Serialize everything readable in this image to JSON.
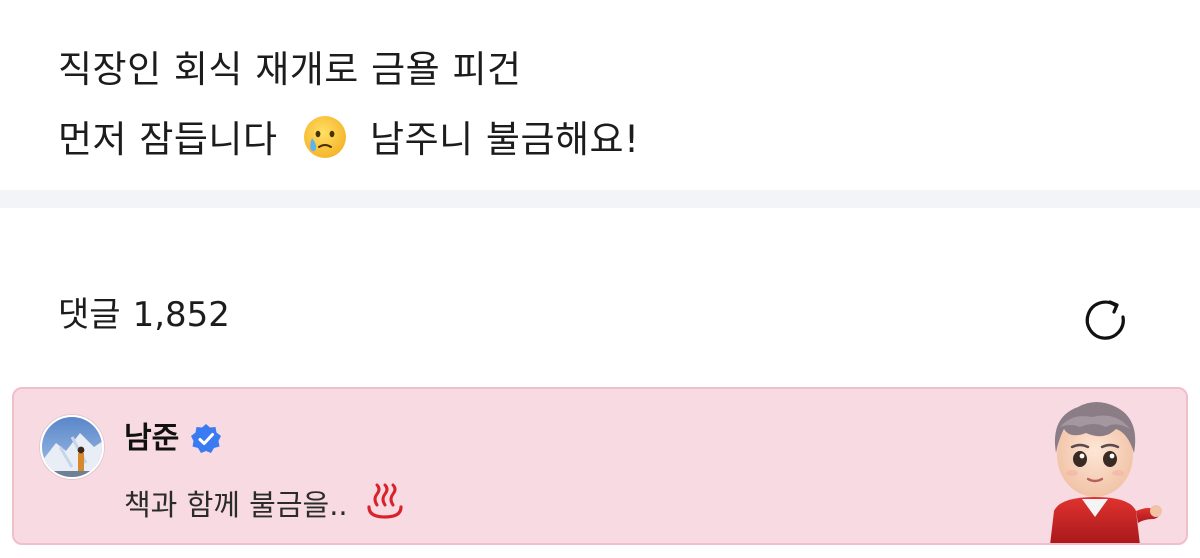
{
  "post": {
    "line1": "직장인 회식 재개로 금욜 피건",
    "line2_before": "먼저 잠듭니다",
    "line2_emoji": "face-holding-back-tears-icon",
    "line2_after": "남주니 불금해요!"
  },
  "comments": {
    "label": "댓글",
    "count": "1,852",
    "refresh_icon": "refresh-icon",
    "pinned": {
      "author": "남준",
      "verified_icon": "verified-badge-icon",
      "text": "책과 함께 불금을..",
      "text_emoji": "hot-springs-icon",
      "sticker_icon": "character-sticker-icon",
      "background_color": "#f8dbe2",
      "border_color": "#f1bfcb"
    }
  },
  "colors": {
    "divider": "#f3f4f8",
    "verified": "#3a7bf2",
    "hotspring": "#d8232a"
  }
}
